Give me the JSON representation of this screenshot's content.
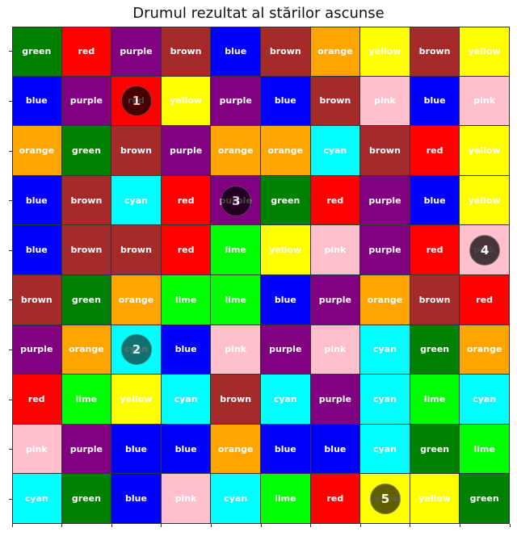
{
  "title": "Drumul rezultat al stărilor ascunse",
  "colors": {
    "green": "#008000",
    "red": "#ff0000",
    "purple": "#800080",
    "brown": "#a52a2a",
    "blue": "#0000ff",
    "orange": "#ffa500",
    "yellow": "#ffff00",
    "pink": "#ffc0cb",
    "cyan": "#00ffff",
    "lime": "#00ff00"
  },
  "grid": [
    [
      "green",
      "red",
      "purple",
      "brown",
      "blue",
      "brown",
      "orange",
      "yellow",
      "brown",
      "yellow"
    ],
    [
      "blue",
      "purple",
      "red",
      "yellow",
      "purple",
      "blue",
      "brown",
      "pink",
      "blue",
      "pink"
    ],
    [
      "orange",
      "green",
      "brown",
      "purple",
      "orange",
      "orange",
      "cyan",
      "brown",
      "red",
      "yellow"
    ],
    [
      "blue",
      "brown",
      "cyan",
      "red",
      "purple",
      "green",
      "red",
      "purple",
      "blue",
      "yellow"
    ],
    [
      "blue",
      "brown",
      "brown",
      "red",
      "lime",
      "yellow",
      "pink",
      "purple",
      "red",
      "pink"
    ],
    [
      "brown",
      "green",
      "orange",
      "lime",
      "lime",
      "blue",
      "purple",
      "orange",
      "brown",
      "red"
    ],
    [
      "purple",
      "orange",
      "cyan",
      "blue",
      "pink",
      "purple",
      "pink",
      "cyan",
      "green",
      "orange"
    ],
    [
      "red",
      "lime",
      "yellow",
      "cyan",
      "brown",
      "cyan",
      "purple",
      "cyan",
      "lime",
      "cyan"
    ],
    [
      "pink",
      "purple",
      "blue",
      "blue",
      "orange",
      "blue",
      "blue",
      "cyan",
      "green",
      "lime"
    ],
    [
      "cyan",
      "green",
      "blue",
      "pink",
      "cyan",
      "lime",
      "red",
      "yellow",
      "yellow",
      "green"
    ]
  ],
  "path": [
    {
      "step": "1",
      "row": 1,
      "col": 2,
      "fill": "#000000"
    },
    {
      "step": "3",
      "row": 3,
      "col": 4,
      "fill": "#000000"
    },
    {
      "step": "4",
      "row": 4,
      "col": 9,
      "fill": "#000000"
    },
    {
      "step": "2",
      "row": 6,
      "col": 2,
      "fill": "#1a3a3a"
    },
    {
      "step": "5",
      "row": 9,
      "col": 7,
      "fill": "#222200"
    }
  ]
}
